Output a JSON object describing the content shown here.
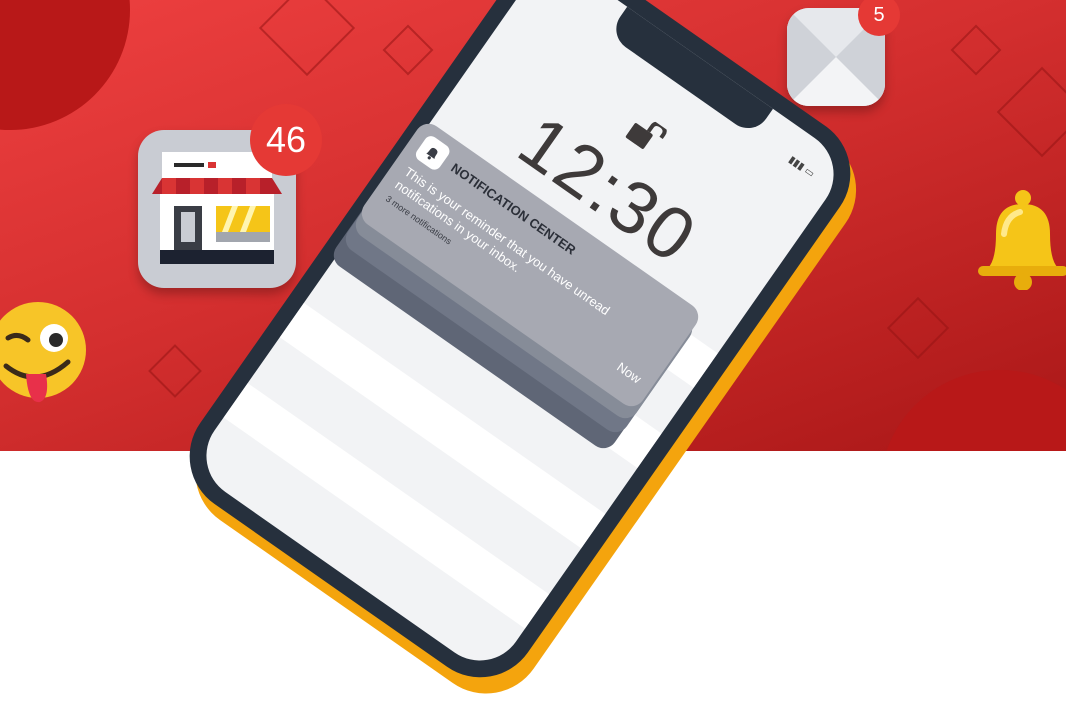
{
  "shop_app": {
    "badge_count": "46",
    "icon": "storefront-icon"
  },
  "mail_app": {
    "badge_count": "5",
    "icon": "envelope-icon"
  },
  "phone": {
    "time": "12:30",
    "lock_icon": "unlocked-padlock-icon"
  },
  "notification": {
    "header": "NOTIFICATION CENTER",
    "message": "This is your reminder that you have unread notifications in your inbox.",
    "more": "3 more notifications",
    "time": "Now",
    "icon": "bell-icon"
  },
  "decor": {
    "bell": "bell-icon",
    "emoji": "winking-face-with-tongue-icon"
  },
  "colors": {
    "background": "#d93434",
    "badge": "#e53935",
    "phone_edge": "#f4a40d",
    "phone_body": "#26303d"
  }
}
